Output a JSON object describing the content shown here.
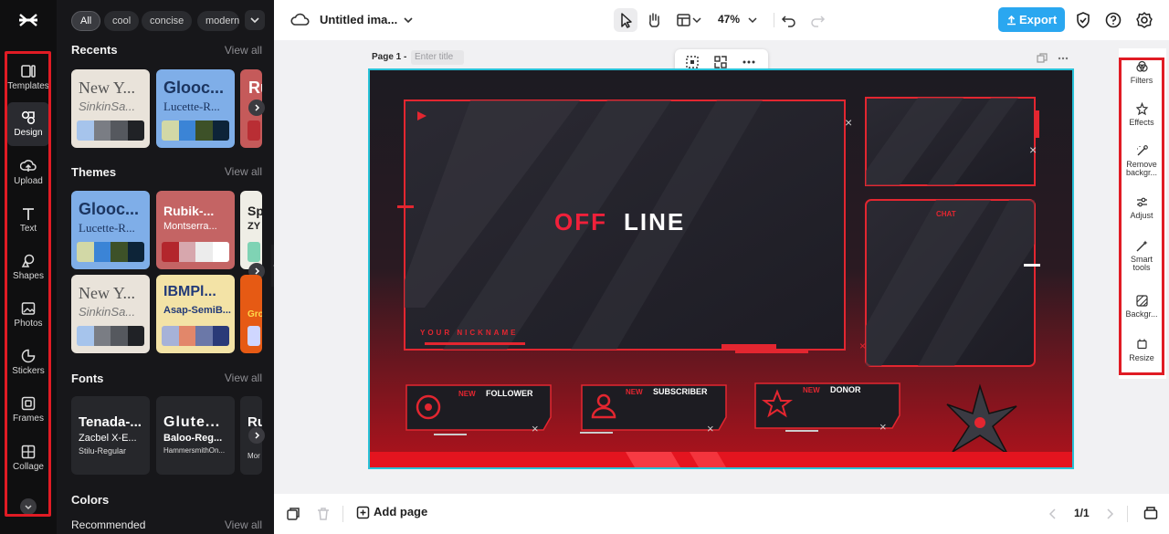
{
  "app": {
    "document_title": "Untitled ima...",
    "zoom": "47%",
    "export_label": "Export",
    "accent_color": "#2aa7f0",
    "highlight_color": "#e01b24"
  },
  "rail": {
    "items": [
      {
        "label": "Templates",
        "icon": "templates-icon"
      },
      {
        "label": "Design",
        "icon": "design-icon"
      },
      {
        "label": "Upload",
        "icon": "upload-icon"
      },
      {
        "label": "Text",
        "icon": "text-icon"
      },
      {
        "label": "Shapes",
        "icon": "shapes-icon"
      },
      {
        "label": "Photos",
        "icon": "photos-icon"
      },
      {
        "label": "Stickers",
        "icon": "stickers-icon"
      },
      {
        "label": "Frames",
        "icon": "frames-icon"
      },
      {
        "label": "Collage",
        "icon": "collage-icon"
      }
    ],
    "active": "Design"
  },
  "panel": {
    "filters": [
      "All",
      "cool",
      "concise",
      "modern"
    ],
    "recents": {
      "title": "Recents",
      "view_all": "View all",
      "cards": [
        {
          "t1": "New Y...",
          "t2": "SinkinSa..."
        },
        {
          "t1": "Glooc...",
          "t2": "Lucette-R..."
        },
        {
          "t1": "Ru",
          "t2": ""
        }
      ]
    },
    "themes": {
      "title": "Themes",
      "view_all": "View all",
      "cards": [
        {
          "t1": "Glooc...",
          "t2": "Lucette-R..."
        },
        {
          "t1": "Rubik-...",
          "t2": "Montserra..."
        },
        {
          "t1": "Sp",
          "t2": "ZY"
        },
        {
          "t1": "New Y...",
          "t2": "SinkinSa..."
        },
        {
          "t1": "IBMPl...",
          "t2": "Asap-SemiB..."
        },
        {
          "t1": "",
          "t2": "Gro"
        }
      ]
    },
    "fonts": {
      "title": "Fonts",
      "view_all": "View all",
      "cards": [
        {
          "f1": "Tenada-...",
          "f2": "Zacbel X-E...",
          "f3": "Stilu-Regular"
        },
        {
          "f1": "Glute...",
          "f2": "Baloo-Reg...",
          "f3": "HammersmithOn..."
        },
        {
          "f1": "Ru",
          "f2": "",
          "f3": "Mor"
        }
      ]
    },
    "colors": {
      "title": "Colors",
      "sub": "Recommended",
      "view_all": "View all"
    }
  },
  "canvas": {
    "page_label": "Page 1 -",
    "title_placeholder": "Enter title",
    "offline_off": "OFF",
    "offline_line": "LINE",
    "nickname": "YOUR NICKNAME",
    "chat": "CHAT",
    "alerts": [
      {
        "new": "NEW",
        "label": "FOLLOWER"
      },
      {
        "new": "NEW",
        "label": "SUBSCRIBER"
      },
      {
        "new": "NEW",
        "label": "DONOR"
      }
    ]
  },
  "right_panel": {
    "items": [
      {
        "label": "Filters",
        "icon": "filters-icon"
      },
      {
        "label": "Effects",
        "icon": "effects-icon"
      },
      {
        "label": "Remove backgr...",
        "icon": "remove-background-icon"
      },
      {
        "label": "Adjust",
        "icon": "adjust-icon"
      },
      {
        "label": "Smart tools",
        "icon": "smart-tools-icon"
      },
      {
        "label": "Backgr...",
        "icon": "background-icon"
      },
      {
        "label": "Resize",
        "icon": "resize-icon"
      }
    ]
  },
  "bottom": {
    "add_page": "Add page",
    "page_count": "1/1"
  }
}
